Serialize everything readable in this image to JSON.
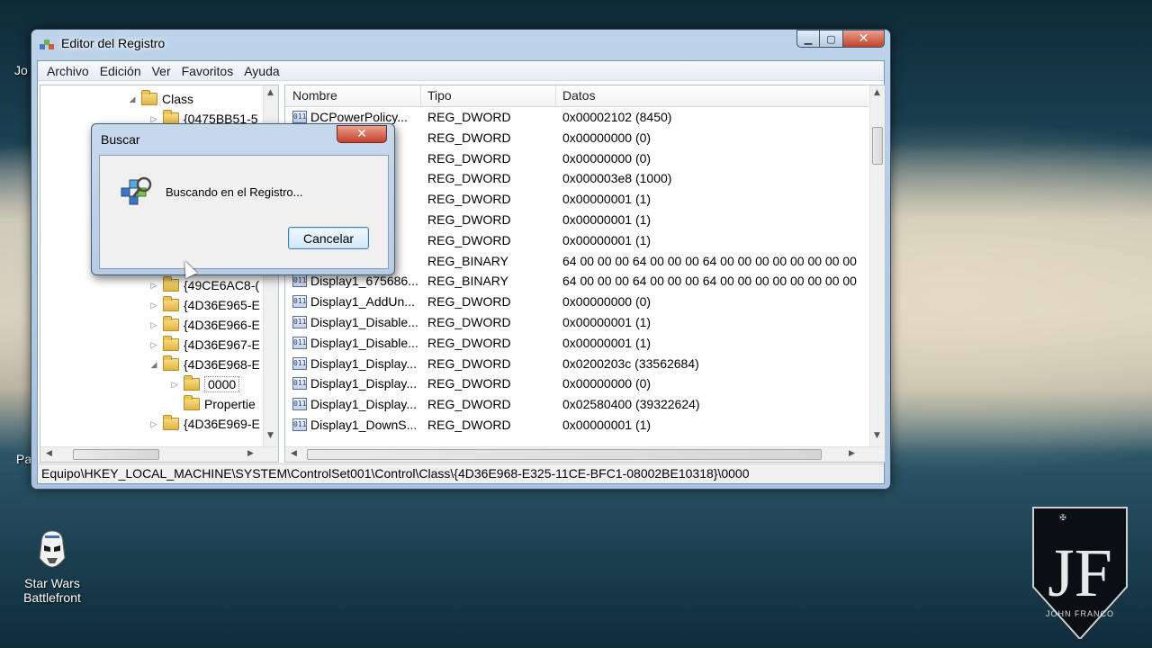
{
  "desktop": {
    "icon_label": "Star Wars Battlefront",
    "partial_label_1": "Jo",
    "partial_label_2": "Pa"
  },
  "window": {
    "title": "Editor del Registro",
    "controls": [
      "minimize-icon",
      "maximize-icon",
      "close-icon"
    ]
  },
  "menu": [
    "Archivo",
    "Edición",
    "Ver",
    "Favoritos",
    "Ayuda"
  ],
  "tree": {
    "root": "Class",
    "items": [
      {
        "label": "{0475BB51-5",
        "expanded": false
      },
      {
        "label": "{49CE6AC8-(",
        "expanded": false
      },
      {
        "label": "{4D36E965-E",
        "expanded": false
      },
      {
        "label": "{4D36E966-E",
        "expanded": false
      },
      {
        "label": "{4D36E967-E",
        "expanded": false
      },
      {
        "label": "{4D36E968-E",
        "expanded": true
      },
      {
        "label": "0000",
        "child": true,
        "selected": true
      },
      {
        "label": "Propertie",
        "child": true
      },
      {
        "label": "{4D36E969-E",
        "expanded": false
      }
    ]
  },
  "list": {
    "columns": [
      "Nombre",
      "Tipo",
      "Datos"
    ],
    "rows": [
      {
        "name": "DCPowerPolicy...",
        "type": "REG_DWORD",
        "data": "0x00002102 (8450)"
      },
      {
        "name": "",
        "type": "REG_DWORD",
        "data": "0x00000000 (0)"
      },
      {
        "name": "",
        "type": "REG_DWORD",
        "data": "0x00000000 (0)"
      },
      {
        "name": "",
        "type": "REG_DWORD",
        "data": "0x000003e8 (1000)"
      },
      {
        "name": "",
        "type": "REG_DWORD",
        "data": "0x00000001 (1)"
      },
      {
        "name": "",
        "type": "REG_DWORD",
        "data": "0x00000001 (1)"
      },
      {
        "name": "",
        "type": "REG_DWORD",
        "data": "0x00000001 (1)"
      },
      {
        "name": "",
        "type": "REG_BINARY",
        "data": "64 00 00 00 64 00 00 00 64 00 00 00 00 00 00 00 00"
      },
      {
        "name": "Display1_675686...",
        "type": "REG_BINARY",
        "data": "64 00 00 00 64 00 00 00 64 00 00 00 00 00 00 00 00"
      },
      {
        "name": "Display1_AddUn...",
        "type": "REG_DWORD",
        "data": "0x00000000 (0)"
      },
      {
        "name": "Display1_Disable...",
        "type": "REG_DWORD",
        "data": "0x00000001 (1)"
      },
      {
        "name": "Display1_Disable...",
        "type": "REG_DWORD",
        "data": "0x00000001 (1)"
      },
      {
        "name": "Display1_Display...",
        "type": "REG_DWORD",
        "data": "0x0200203c (33562684)"
      },
      {
        "name": "Display1_Display...",
        "type": "REG_DWORD",
        "data": "0x00000000 (0)"
      },
      {
        "name": "Display1_Display...",
        "type": "REG_DWORD",
        "data": "0x02580400 (39322624)"
      },
      {
        "name": "Display1_DownS...",
        "type": "REG_DWORD",
        "data": "0x00000001 (1)"
      }
    ]
  },
  "status": "Equipo\\HKEY_LOCAL_MACHINE\\SYSTEM\\ControlSet001\\Control\\Class\\{4D36E968-E325-11CE-BFC1-08002BE10318}\\0000",
  "dialog": {
    "title": "Buscar",
    "message": "Buscando en el Registro...",
    "cancel": "Cancelar"
  },
  "logo": {
    "monogram": "JF",
    "caption": "JOHN FRANCO"
  }
}
